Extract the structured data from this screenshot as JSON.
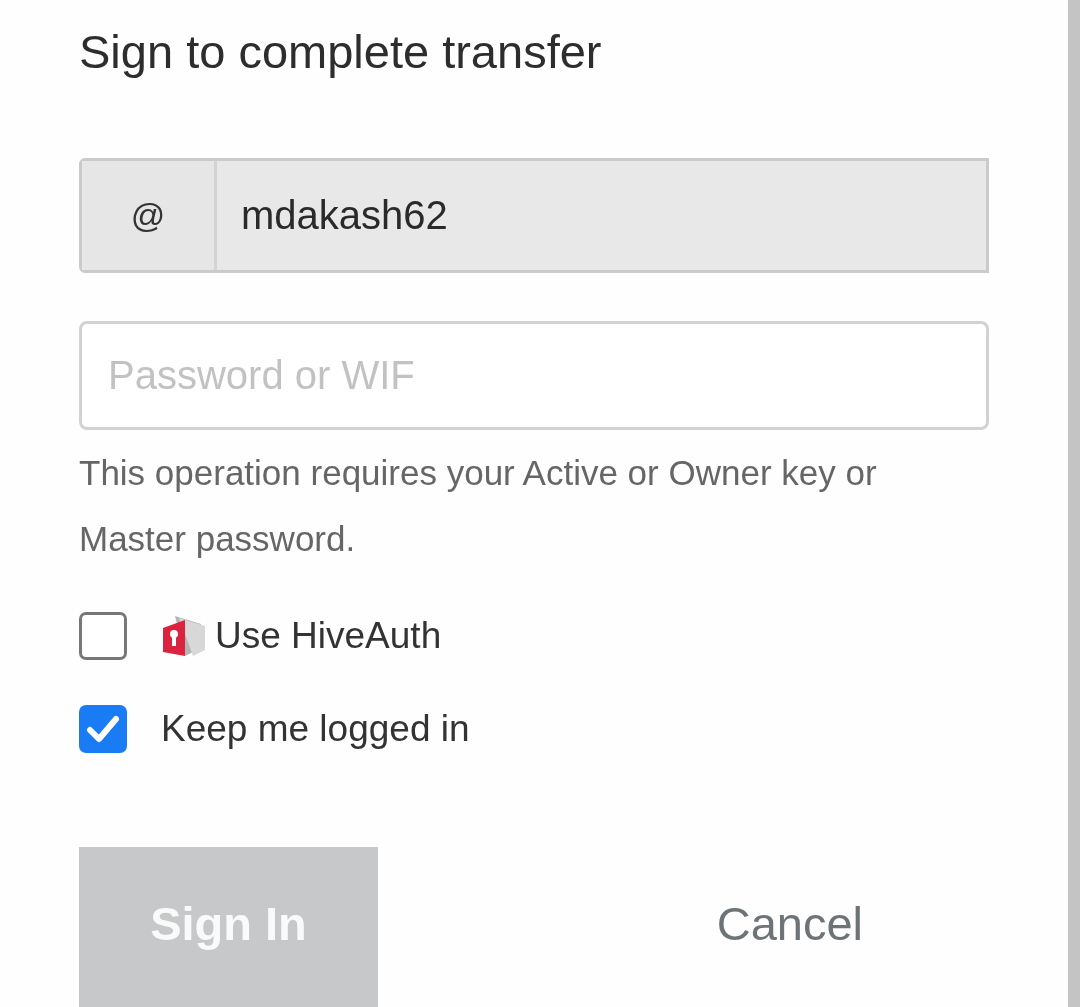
{
  "dialog": {
    "title": "Sign to complete transfer",
    "username": {
      "prefix": "@",
      "value": "mdakash62",
      "disabled": true
    },
    "password": {
      "placeholder": "Password or WIF"
    },
    "help": "This operation requires your Active or Owner key or Master password.",
    "options": [
      {
        "kind": "with-icon",
        "label": "Use HiveAuth",
        "checked": false
      },
      {
        "kind": "plain",
        "label": "Keep me logged in",
        "checked": true
      }
    ],
    "buttons": [
      {
        "kind": "primary",
        "label": "Sign In",
        "disabled": true
      },
      {
        "kind": "link",
        "label": "Cancel",
        "disabled": false
      }
    ]
  }
}
